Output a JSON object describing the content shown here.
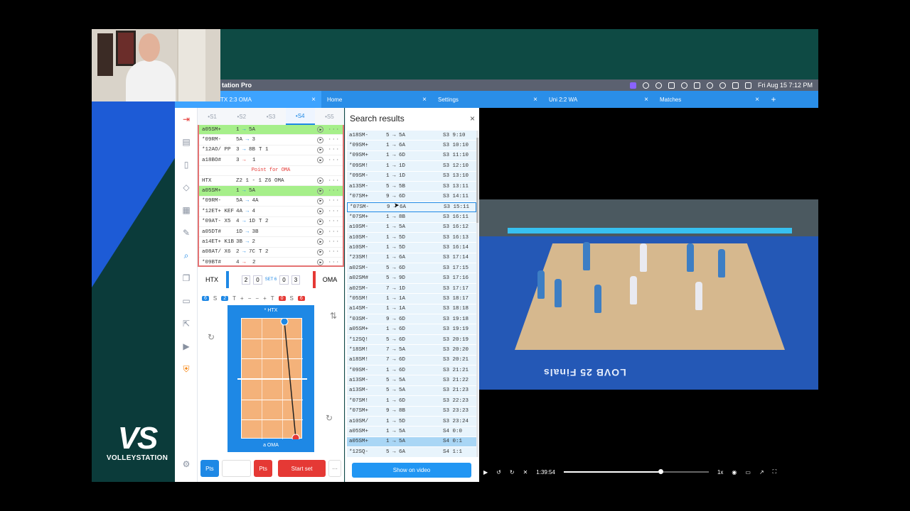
{
  "menubar": {
    "app_title": "tation Pro",
    "datetime": "Fri Aug 15  7:12 PM"
  },
  "tabs": [
    {
      "label": "TX 2:3 OMA",
      "active": true
    },
    {
      "label": "Home"
    },
    {
      "label": "Settings"
    },
    {
      "label": "Uni 2:2 WA"
    },
    {
      "label": "Matches"
    }
  ],
  "tab_add": "+",
  "left_toolbar_icons": [
    "exit-icon",
    "document-icon",
    "bookmark-icon",
    "tag-icon",
    "calendar-icon",
    "brush-icon",
    "search-icon",
    "copy-icon",
    "tablet-icon",
    "export-icon",
    "video-icon",
    "shield-icon",
    "settings-icon"
  ],
  "set_tabs": [
    "•S1",
    "•S2",
    "•S3",
    "•S4",
    "•S5"
  ],
  "rallies": [
    {
      "code": "a05SM+",
      "a": "1",
      "b": "5A",
      "extra": "",
      "hl": true
    },
    {
      "code": "*09RM-",
      "a": "5A",
      "b": "3",
      "extra": ""
    },
    {
      "code": "*12AO/ PP",
      "a": "3",
      "b": "8B",
      "extra": "T 1"
    },
    {
      "code": "a18BO#",
      "a": "3",
      "b": "",
      "extra": "1",
      "red": true
    },
    {
      "note": "Point for OMA"
    },
    {
      "code": "HTX",
      "score": "Z2 1 - 1 Z6 OMA"
    },
    {
      "code": "a05SM+",
      "a": "1",
      "b": "5A",
      "extra": "",
      "hl": true
    },
    {
      "code": "*09RM-",
      "a": "5A",
      "b": "4A",
      "extra": ""
    },
    {
      "code": "*12ET+ KEF",
      "a": "4A",
      "b": "4",
      "extra": ""
    },
    {
      "code": "*09AT- X5",
      "a": "4",
      "b": "1D",
      "extra": "T 2"
    },
    {
      "code": "a05DT#",
      "a": "1D",
      "b": "3B",
      "extra": ""
    },
    {
      "code": "a14ET+ K1B",
      "a": "3B",
      "b": "2",
      "extra": ""
    },
    {
      "code": "a08AT/ X6",
      "a": "2",
      "b": "7C",
      "extra": "T 2"
    },
    {
      "code": "*09BT#",
      "a": "4",
      "b": "",
      "extra": "2",
      "red": true
    }
  ],
  "scoreboard": {
    "home": "HTX",
    "away": "OMA",
    "home_sets": "2",
    "home_pts": "0",
    "set_label": "SET 6",
    "away_pts": "0",
    "away_sets": "3"
  },
  "controls": {
    "home_serve": "6",
    "home_serve_lbl": "S",
    "home_to": "2",
    "home_to_lbl": "T",
    "plus": "+",
    "minus": "−",
    "away_to_lbl": "T",
    "away_to": "0",
    "away_serve_lbl": "S",
    "away_serve": "6"
  },
  "court": {
    "top_label": "* HTX",
    "bottom_label": "a OMA"
  },
  "bottom": {
    "pts_home": "Pts",
    "pts_away": "Pts",
    "start": "Start set",
    "more": "···"
  },
  "search": {
    "title": "Search results",
    "close": "×",
    "show_button": "Show on video",
    "results": [
      {
        "c": "a18SM-",
        "m": "5 → 5A",
        "s": "S3  9:10"
      },
      {
        "c": "*09SM+",
        "m": "1 → 6A",
        "s": "S3 10:10"
      },
      {
        "c": "*09SM+",
        "m": "1 → 6D",
        "s": "S3 11:10"
      },
      {
        "c": "*09SM!",
        "m": "1 → 1D",
        "s": "S3 12:10"
      },
      {
        "c": "*09SM-",
        "m": "1 → 1D",
        "s": "S3 13:10"
      },
      {
        "c": "a13SM-",
        "m": "5 → 5B",
        "s": "S3 13:11"
      },
      {
        "c": "*07SM+",
        "m": "9 → 6D",
        "s": "S3 14:11"
      },
      {
        "c": "*07SM-",
        "m": "9 → 6A",
        "s": "S3 15:11",
        "cur": true
      },
      {
        "c": "*07SM+",
        "m": "1 → 8B",
        "s": "S3 16:11"
      },
      {
        "c": "a10SM-",
        "m": "1 → 5A",
        "s": "S3 16:12"
      },
      {
        "c": "a10SM-",
        "m": "1 → 5D",
        "s": "S3 16:13"
      },
      {
        "c": "a10SM-",
        "m": "1 → 5D",
        "s": "S3 16:14"
      },
      {
        "c": "*23SM!",
        "m": "1 → 6A",
        "s": "S3 17:14"
      },
      {
        "c": "a02SM-",
        "m": "5 → 6D",
        "s": "S3 17:15"
      },
      {
        "c": "a02SM#",
        "m": "5 → 9D",
        "s": "S3 17:16"
      },
      {
        "c": "a02SM-",
        "m": "7 → 1D",
        "s": "S3 17:17"
      },
      {
        "c": "*05SM!",
        "m": "1 → 1A",
        "s": "S3 18:17"
      },
      {
        "c": "a14SM-",
        "m": "1 → 1A",
        "s": "S3 18:18"
      },
      {
        "c": "*03SM-",
        "m": "9 → 6D",
        "s": "S3 19:18"
      },
      {
        "c": "a05SM+",
        "m": "1 → 6D",
        "s": "S3 19:19"
      },
      {
        "c": "*12SQ!",
        "m": "5 → 6D",
        "s": "S3 20:19"
      },
      {
        "c": "*18SM!",
        "m": "7 → 5A",
        "s": "S3 20:20"
      },
      {
        "c": "a18SM!",
        "m": "7 → 6D",
        "s": "S3 20:21"
      },
      {
        "c": "*09SM-",
        "m": "1 → 6D",
        "s": "S3 21:21"
      },
      {
        "c": "a13SM-",
        "m": "5 → 5A",
        "s": "S3 21:22"
      },
      {
        "c": "a13SM-",
        "m": "5 → 5A",
        "s": "S3 21:23"
      },
      {
        "c": "*07SM!",
        "m": "1 → 6D",
        "s": "S3 22:23"
      },
      {
        "c": "*07SM+",
        "m": "9 → 8B",
        "s": "S3 23:23"
      },
      {
        "c": "a10SM/",
        "m": "1 → 5D",
        "s": "S3 23:24"
      },
      {
        "c": "a05SM+",
        "m": "1 → 5A",
        "s": "S4  0:0"
      },
      {
        "c": "a05SM+",
        "m": "1 → 5A",
        "s": "S4  0:1",
        "sel": true
      },
      {
        "c": "*12SQ-",
        "m": "5 → 6A",
        "s": "S4  1:1"
      }
    ]
  },
  "video": {
    "time": "1:39:54",
    "speed": "1x",
    "progress": 0.65,
    "floor_text": "LOVB 25 Finals"
  },
  "desktop": {
    "brand_mark": "VS",
    "brand_name": "VOLLEYSTATION"
  }
}
